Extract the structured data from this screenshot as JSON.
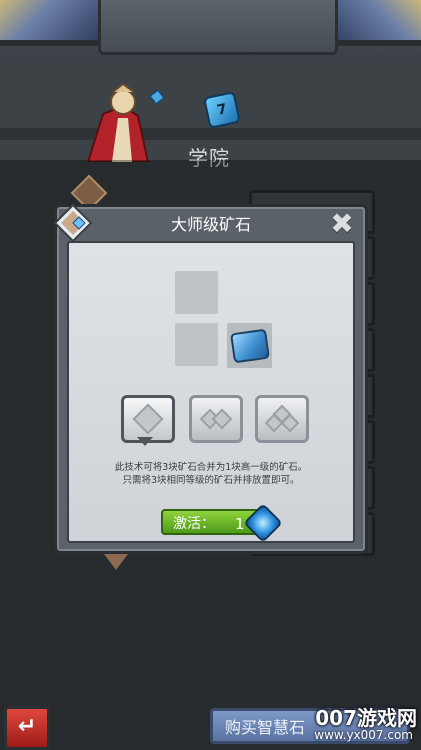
{
  "academy": {
    "title": "学院",
    "level": "7"
  },
  "modal": {
    "title": "大师级矿石",
    "description_line1": "此技术可将3块矿石合并为1块高一级的矿石。",
    "description_line2": "只需将3块相同等级的矿石并排放置即可。",
    "activate_label": "激活：",
    "activate_cost": "1"
  },
  "bottom": {
    "back_icon": "back-arrow-icon",
    "buy_label": "购买智慧石"
  },
  "watermark": {
    "brand": "007游戏网",
    "url": "www.yx007.com"
  },
  "colors": {
    "accent_green": "#6bb52a",
    "gem_blue": "#2c8fe0",
    "back_red": "#c8352c"
  }
}
